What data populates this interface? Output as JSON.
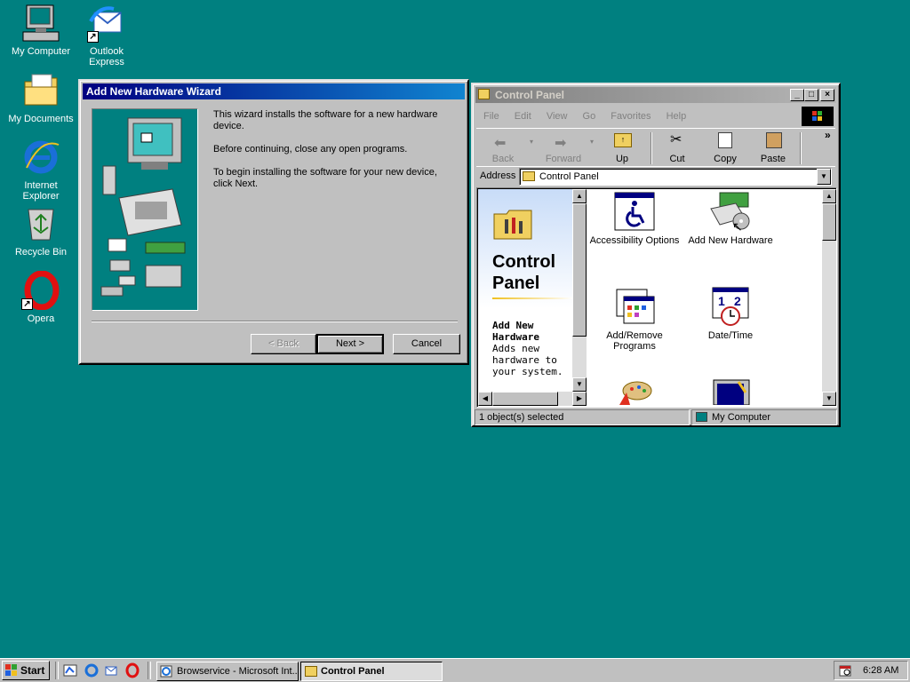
{
  "desktop": {
    "icons": [
      {
        "label": "My Computer",
        "icon": "my-computer-icon"
      },
      {
        "label": "Outlook Express",
        "icon": "outlook-express-icon"
      },
      {
        "label": "My Documents",
        "icon": "my-documents-icon"
      },
      {
        "label": "Internet Explorer",
        "icon": "internet-explorer-icon"
      },
      {
        "label": "Recycle Bin",
        "icon": "recycle-bin-icon"
      },
      {
        "label": "Opera",
        "icon": "opera-icon"
      }
    ]
  },
  "wizard": {
    "title": "Add New Hardware Wizard",
    "para1": "This wizard installs the software for a new hardware device.",
    "para2": "Before continuing, close any open programs.",
    "para3": "To begin installing the software for your new device, click Next.",
    "back_label": "< Back",
    "next_label": "Next >",
    "cancel_label": "Cancel"
  },
  "control_panel": {
    "title": "Control Panel",
    "menu": [
      "File",
      "Edit",
      "View",
      "Go",
      "Favorites",
      "Help"
    ],
    "toolbar": {
      "back": "Back",
      "forward": "Forward",
      "up": "Up",
      "cut": "Cut",
      "copy": "Copy",
      "paste": "Paste",
      "more": "»"
    },
    "address_label": "Address",
    "address_value": "Control Panel",
    "side_title": "Control Panel",
    "side_heading": "Add New Hardware",
    "side_desc": "Adds new hardware to your system.",
    "items": [
      {
        "label": "Accessibility Options",
        "icon": "accessibility-icon"
      },
      {
        "label": "Add New Hardware",
        "icon": "add-hardware-icon"
      },
      {
        "label": "Add/Remove Programs",
        "icon": "add-remove-programs-icon"
      },
      {
        "label": "Date/Time",
        "icon": "date-time-icon"
      }
    ],
    "status_left": "1 object(s) selected",
    "status_right": "My Computer"
  },
  "taskbar": {
    "start": "Start",
    "tasks": [
      {
        "label": "Browservice - Microsoft Int...",
        "active": false
      },
      {
        "label": "Control Panel",
        "active": true
      }
    ],
    "clock": "6:28 AM"
  },
  "colors": {
    "desktop": "#008080",
    "title_active": "#000080",
    "face": "#c0c0c0"
  }
}
